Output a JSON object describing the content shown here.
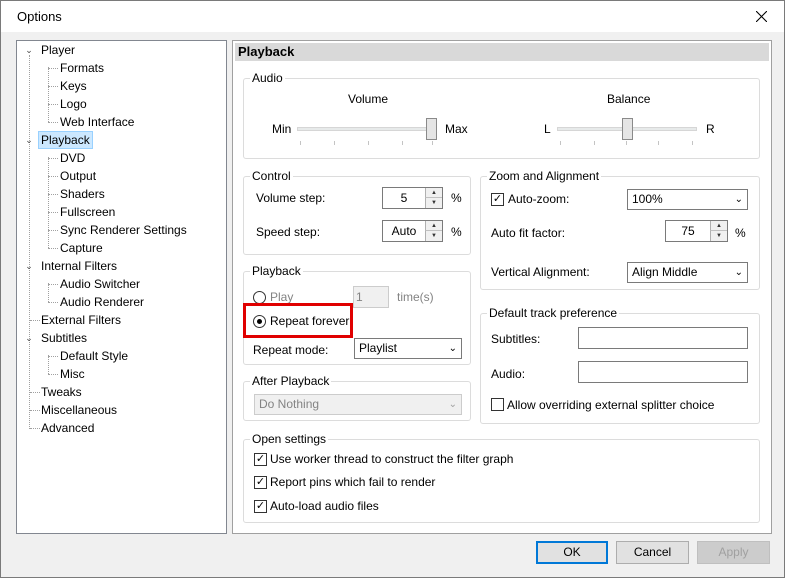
{
  "window": {
    "title": "Options"
  },
  "tree": {
    "items": [
      {
        "label": "Player"
      },
      {
        "label": "Formats"
      },
      {
        "label": "Keys"
      },
      {
        "label": "Logo"
      },
      {
        "label": "Web Interface"
      },
      {
        "label": "Playback"
      },
      {
        "label": "DVD"
      },
      {
        "label": "Output"
      },
      {
        "label": "Shaders"
      },
      {
        "label": "Fullscreen"
      },
      {
        "label": "Sync Renderer Settings"
      },
      {
        "label": "Capture"
      },
      {
        "label": "Internal Filters"
      },
      {
        "label": "Audio Switcher"
      },
      {
        "label": "Audio Renderer"
      },
      {
        "label": "External Filters"
      },
      {
        "label": "Subtitles"
      },
      {
        "label": "Default Style"
      },
      {
        "label": "Misc"
      },
      {
        "label": "Tweaks"
      },
      {
        "label": "Miscellaneous"
      },
      {
        "label": "Advanced"
      }
    ],
    "selected": "Playback"
  },
  "panel": {
    "title": "Playback",
    "audio": {
      "group_label": "Audio",
      "volume_label": "Volume",
      "volume_min": "Min",
      "volume_max": "Max",
      "volume_value": 1.0,
      "balance_label": "Balance",
      "balance_left": "L",
      "balance_right": "R",
      "balance_value": 0.5
    },
    "control": {
      "group_label": "Control",
      "volume_step_label": "Volume step:",
      "volume_step_value": "5",
      "volume_step_unit": "%",
      "speed_step_label": "Speed step:",
      "speed_step_value": "Auto",
      "speed_step_unit": "%"
    },
    "zoom": {
      "group_label": "Zoom and Alignment",
      "auto_zoom_label": "Auto-zoom:",
      "auto_zoom_checked": true,
      "auto_zoom_value": "100%",
      "auto_fit_label": "Auto fit factor:",
      "auto_fit_value": "75",
      "auto_fit_unit": "%",
      "vertical_alignment_label": "Vertical Alignment:",
      "vertical_alignment_value": "Align Middle"
    },
    "playback": {
      "group_label": "Playback",
      "play_label": "Play",
      "play_times_value": "1",
      "times_label": "time(s)",
      "repeat_forever_label": "Repeat forever",
      "repeat_forever_selected": true,
      "repeat_mode_label": "Repeat mode:",
      "repeat_mode_value": "Playlist"
    },
    "track_pref": {
      "group_label": "Default track preference",
      "subtitles_label": "Subtitles:",
      "subtitles_value": "",
      "audio_label": "Audio:",
      "audio_value": "",
      "allow_override_label": "Allow overriding external splitter choice",
      "allow_override_checked": false
    },
    "after_playback": {
      "group_label": "After Playback",
      "value": "Do Nothing"
    },
    "open_settings": {
      "group_label": "Open settings",
      "worker_thread_label": "Use worker thread to construct the filter graph",
      "worker_thread_checked": true,
      "report_pins_label": "Report pins which fail to render",
      "report_pins_checked": true,
      "autoload_audio_label": "Auto-load audio files",
      "autoload_audio_checked": true
    }
  },
  "buttons": {
    "ok": "OK",
    "cancel": "Cancel",
    "apply": "Apply"
  },
  "colors": {
    "selection": "#cce8ff",
    "highlight_box": "#e00000",
    "default_button_border": "#0078d7"
  }
}
